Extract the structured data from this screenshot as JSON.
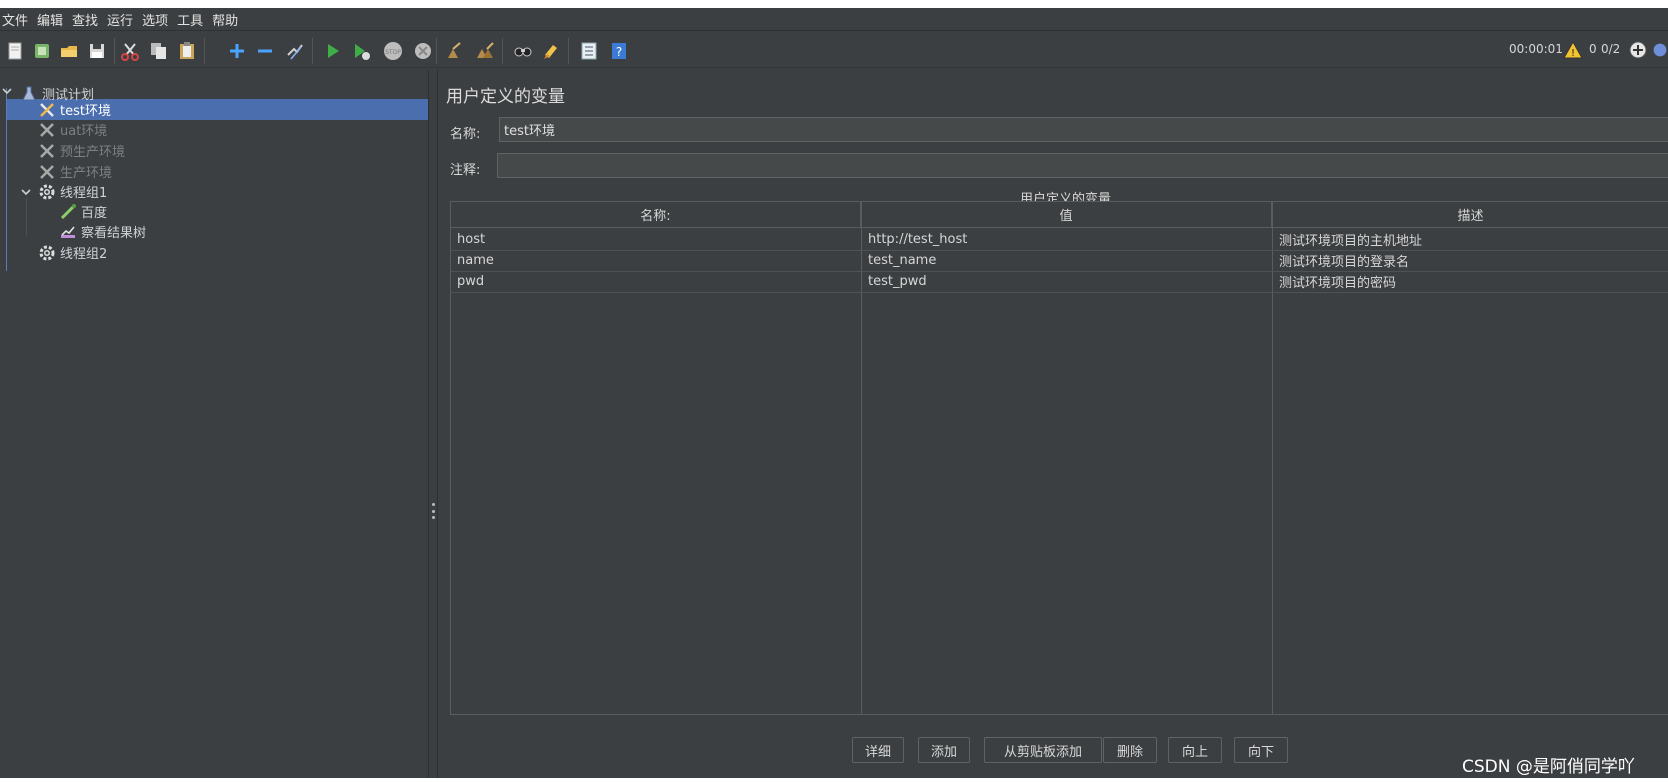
{
  "menu": [
    "文件",
    "编辑",
    "查找",
    "运行",
    "选项",
    "工具",
    "帮助"
  ],
  "status": {
    "timer": "00:00:01",
    "warnings": "0",
    "threads": "0/2"
  },
  "tree": {
    "root": "测试计划",
    "items": [
      {
        "label": "test环境",
        "selected": true,
        "disabled": false
      },
      {
        "label": "uat环境",
        "selected": false,
        "disabled": true
      },
      {
        "label": "预生产环境",
        "selected": false,
        "disabled": true
      },
      {
        "label": "生产环境",
        "selected": false,
        "disabled": true
      },
      {
        "label": "线程组1"
      },
      {
        "label": "百度"
      },
      {
        "label": "察看结果树"
      },
      {
        "label": "线程组2"
      }
    ]
  },
  "panel": {
    "title": "用户定义的变量",
    "name_label": "名称:",
    "name_value": "test环境",
    "comment_label": "注释:",
    "comment_value": "",
    "table_caption": "用户定义的变量",
    "columns": [
      "名称:",
      "值",
      "描述"
    ],
    "rows": [
      [
        "host",
        "http://test_host",
        "测试环境项目的主机地址"
      ],
      [
        "name",
        "test_name",
        "测试环境项目的登录名"
      ],
      [
        "pwd",
        "test_pwd",
        "测试环境项目的密码"
      ]
    ],
    "buttons": [
      "详细",
      "添加",
      "从剪贴板添加",
      "删除",
      "向上",
      "向下"
    ]
  },
  "watermark": "CSDN @是阿俏同学吖",
  "icons": [
    "new-icon",
    "templates-icon",
    "open-icon",
    "save-icon",
    "cut-icon",
    "copy-icon",
    "paste-icon",
    "expand-icon",
    "collapse-icon",
    "toggle-icon",
    "start-icon",
    "start-no-pause-icon",
    "stop-icon",
    "shutdown-icon",
    "clear-icon",
    "clear-all-icon",
    "search-icon",
    "reset-search-icon",
    "function-helper-icon",
    "help-icon"
  ]
}
